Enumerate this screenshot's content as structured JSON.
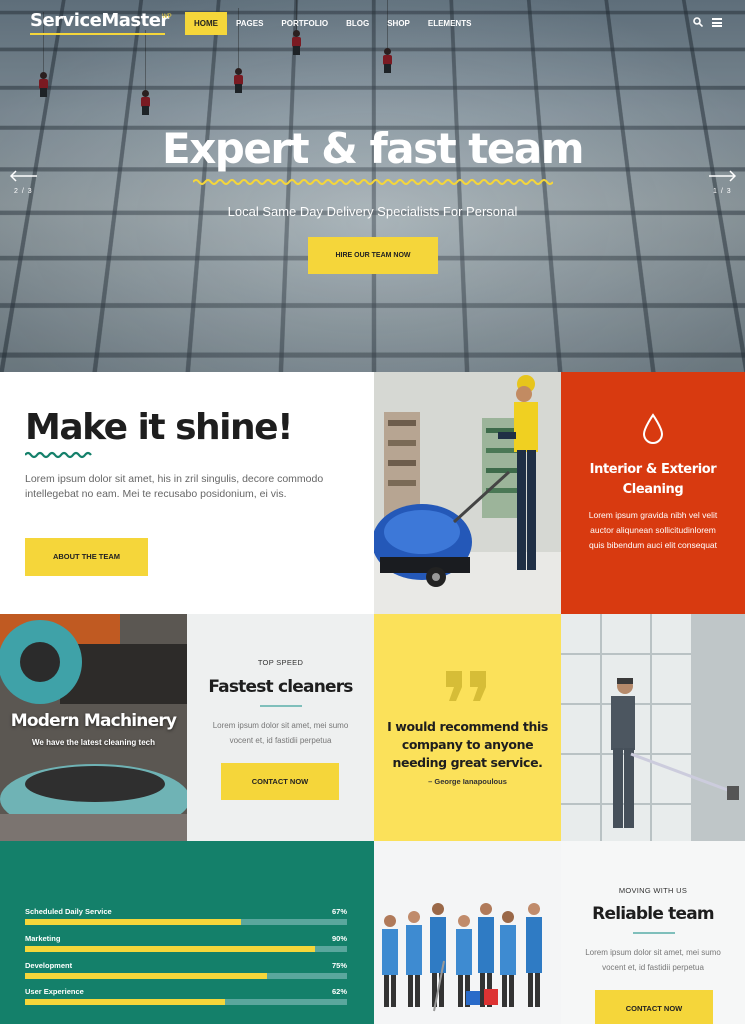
{
  "colors": {
    "accent_yellow": "#f5d63a",
    "orange": "#d83a10",
    "green": "#14806a",
    "teal_line": "#7fbfbb"
  },
  "header": {
    "logo": "ServiceMaster",
    "logo_sup": "WP",
    "nav": [
      {
        "label": "HOME",
        "active": true
      },
      {
        "label": "PAGES"
      },
      {
        "label": "PORTFOLIO"
      },
      {
        "label": "BLOG"
      },
      {
        "label": "SHOP"
      },
      {
        "label": "ELEMENTS"
      }
    ],
    "icons": [
      "search-icon",
      "hamburger-menu-icon"
    ]
  },
  "hero": {
    "title": "Expert & fast team",
    "subtitle": "Local Same Day Delivery Specialists For Personal",
    "button": "HIRE OUR TEAM NOW",
    "slide_prev": "2 / 3",
    "slide_next": "1 / 3"
  },
  "shine": {
    "title": "Make it shine!",
    "text": "Lorem ipsum dolor sit amet, his in zril singulis, decore commodo intellegebat no eam. Mei te recusabo posidonium, ei vis.",
    "button": "ABOUT THE TEAM"
  },
  "interior": {
    "icon": "water-drop-icon",
    "title_line1": "Interior & Exterior",
    "title_line2": "Cleaning",
    "text": "Lorem ipsum gravida nibh vel velit auctor aliqunean sollicitudinlorem quis bibendum auci elit consequat"
  },
  "machinery": {
    "title": "Modern Machinery",
    "subtitle": "We have the latest cleaning tech"
  },
  "fastest": {
    "eyebrow": "TOP SPEED",
    "title": "Fastest cleaners",
    "text": "Lorem ipsum dolor sit amet, mei sumo vocent et, id fastidii perpetua",
    "button": "CONTACT NOW"
  },
  "testimonial": {
    "quote": "I would recommend this company to anyone needing great service.",
    "author": "– George Ianapoulous"
  },
  "skills": [
    {
      "label": "Scheduled Daily Service",
      "pct": "67%",
      "value": 67
    },
    {
      "label": "Marketing",
      "pct": "90%",
      "value": 90
    },
    {
      "label": "Development",
      "pct": "75%",
      "value": 75
    },
    {
      "label": "User Experience",
      "pct": "62%",
      "value": 62
    }
  ],
  "reliable": {
    "eyebrow": "MOVING WITH US",
    "title": "Reliable team",
    "text": "Lorem ipsum dolor sit amet, mei sumo vocent et, id fastidii perpetua",
    "button": "CONTACT NOW"
  }
}
